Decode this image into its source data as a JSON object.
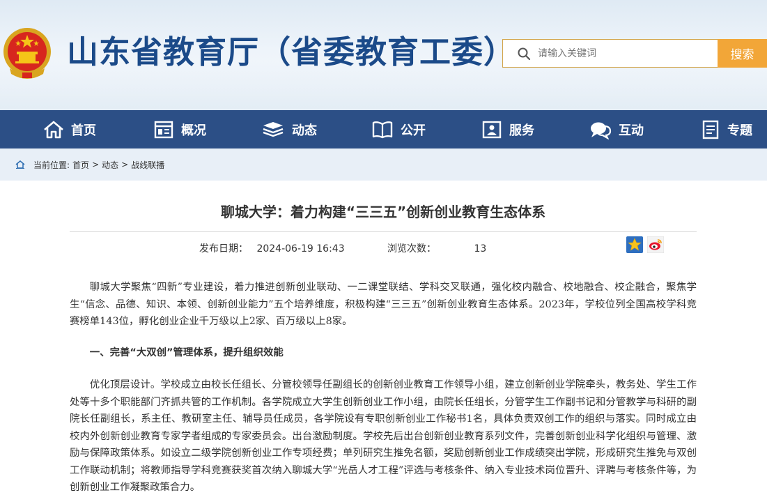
{
  "header": {
    "site_title": "山东省教育厅（省委教育工委）",
    "search_placeholder": "请输入关键词",
    "search_button": "搜索"
  },
  "nav": {
    "items": [
      {
        "label": "首页",
        "icon": "home-icon"
      },
      {
        "label": "概况",
        "icon": "overview-icon"
      },
      {
        "label": "动态",
        "icon": "news-stack-icon"
      },
      {
        "label": "公开",
        "icon": "book-icon"
      },
      {
        "label": "服务",
        "icon": "service-icon"
      },
      {
        "label": "互动",
        "icon": "chat-icon"
      },
      {
        "label": "专题",
        "icon": "document-icon"
      }
    ]
  },
  "breadcrumb": {
    "prefix": "当前位置:",
    "items": [
      "首页",
      "动态",
      "战线联播"
    ],
    "separator": ">"
  },
  "article": {
    "title": "聊城大学：着力构建“三三五”创新创业教育生态体系",
    "date_label": "发布日期：",
    "date_value": "2024-06-19 16:43",
    "views_label": "浏览次数：",
    "views_value": "13",
    "share_icons": [
      "star-favorite-icon",
      "weibo-icon"
    ],
    "paragraphs": [
      "聊城大学聚焦“四新”专业建设，着力推进创新创业联动、一二课堂联结、学科交叉联通，强化校内融合、校地融合、校企融合，聚焦学生“信念、品德、知识、本领、创新创业能力”五个培养维度，积极构建“三三五”创新创业教育生态体系。2023年，学校位列全国高校学科竞赛榜单143位，孵化创业企业千万级以上2家、百万级以上8家。",
      "一、完善“大双创”管理体系，提升组织效能",
      "优化顶层设计。学校成立由校长任组长、分管校领导任副组长的创新创业教育工作领导小组，建立创新创业学院牵头，教务处、学生工作处等十多个职能部门齐抓共管的工作机制。各学院成立大学生创新创业工作小组，由院长任组长，分管学生工作副书记和分管教学与科研的副院长任副组长，系主任、教研室主任、辅导员任成员，各学院设有专职创新创业工作秘书1名，具体负责双创工作的组织与落实。同时成立由校内外创新创业教育专家学者组成的专家委员会。出台激励制度。学校先后出台创新创业教育系列文件，完善创新创业科学化组织与管理、激励与保障政策体系。如设立二级学院创新创业工作专项经费；单列研究生推免名额，奖励创新创业工作成绩突出学院，形成研究生推免与双创工作联动机制；将教师指导学科竞赛获奖首次纳入聊城大学“光岳人才工程”评选与考核条件、纳入专业技术岗位晋升、评聘与考核条件等，为创新创业工作凝聚政策合力。"
    ]
  },
  "colors": {
    "nav_bg": "#2c4f86",
    "title_blue": "#1b4a89",
    "search_button_bg": "#f2a638",
    "breadcrumb_bg": "#e8eff7"
  }
}
